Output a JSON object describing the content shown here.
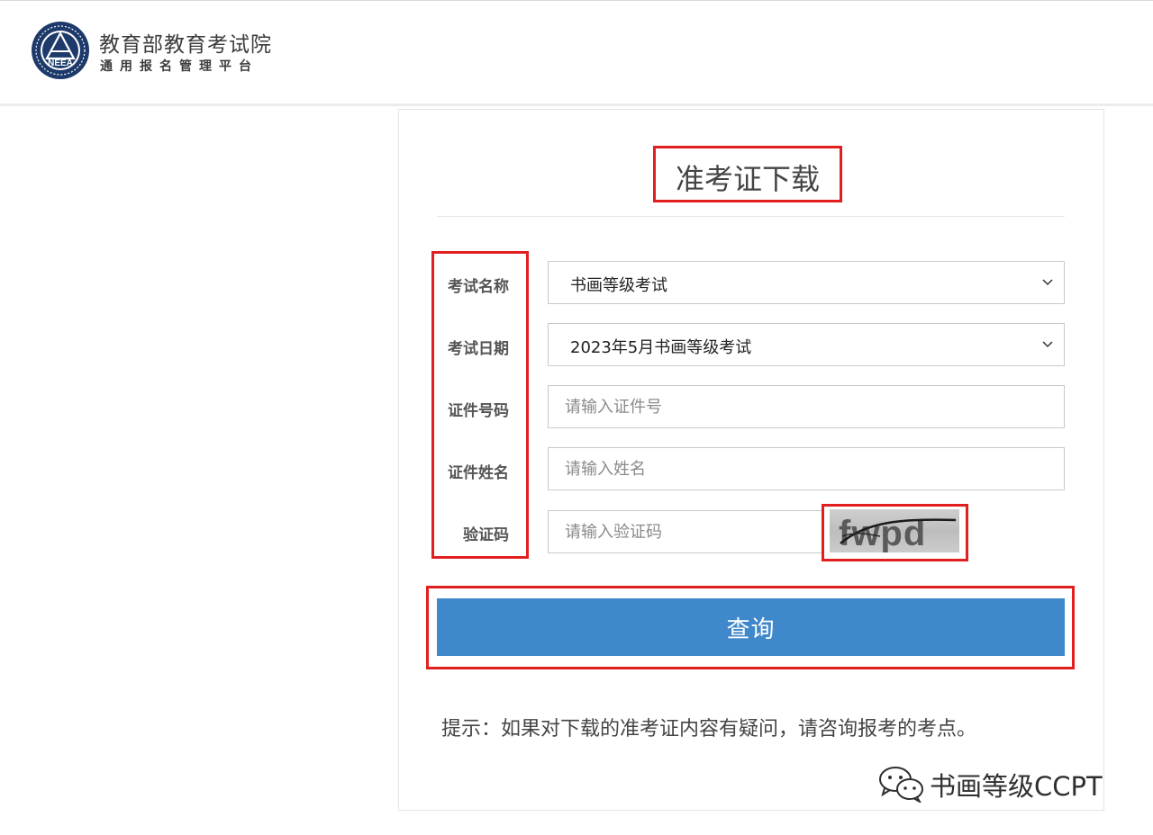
{
  "header": {
    "org_name": "教育部教育考试院",
    "platform_name": "通用报名管理平台",
    "logo_text": "NEEA"
  },
  "page": {
    "title": "准考证下载"
  },
  "form": {
    "exam_name": {
      "label": "考试名称",
      "value": "书画等级考试"
    },
    "exam_date": {
      "label": "考试日期",
      "value": "2023年5月书画等级考试"
    },
    "id_number": {
      "label": "证件号码",
      "placeholder": "请输入证件号"
    },
    "id_name": {
      "label": "证件姓名",
      "placeholder": "请输入姓名"
    },
    "captcha": {
      "label": "验证码",
      "placeholder": "请输入验证码",
      "image_text": "fwpd"
    },
    "submit_label": "查询"
  },
  "hint": "提示：如果对下载的准考证内容有疑问，请咨询报考的考点。",
  "watermark": {
    "text": "书画等级CCPT",
    "icon": "wechat-icon"
  },
  "colors": {
    "primary_button": "#3f88cb",
    "annotation": "#e21f1f",
    "logo_navy": "#1d3a6b"
  }
}
